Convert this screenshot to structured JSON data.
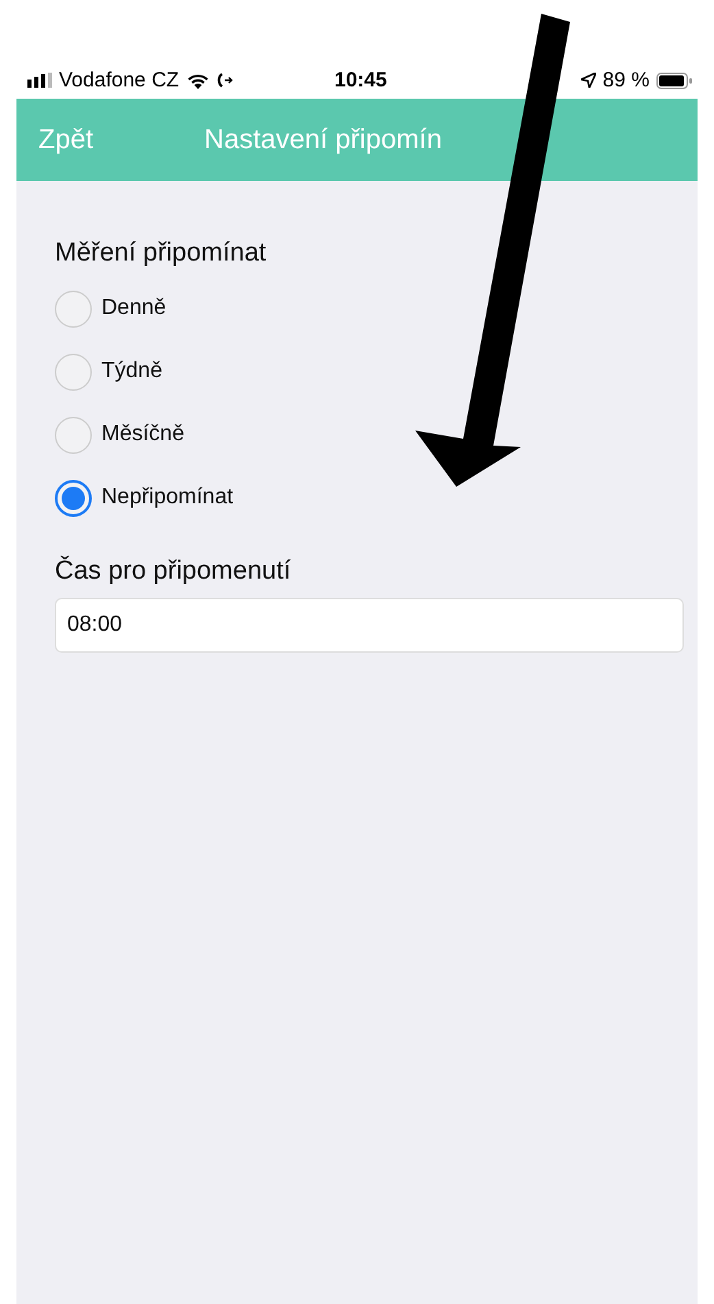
{
  "status_bar": {
    "carrier": "Vodafone CZ",
    "time": "10:45",
    "battery": "89 %"
  },
  "nav_bar": {
    "back": "Zpět",
    "title": "Nastavení připomín"
  },
  "reminder": {
    "label": "Měření připomínat",
    "options": [
      {
        "label": "Denně",
        "selected": false
      },
      {
        "label": "Týdně",
        "selected": false
      },
      {
        "label": "Měsíčně",
        "selected": false
      },
      {
        "label": "Nepřipomínat",
        "selected": true
      }
    ]
  },
  "time": {
    "label": "Čas pro připomenutí",
    "value": "08:00"
  }
}
